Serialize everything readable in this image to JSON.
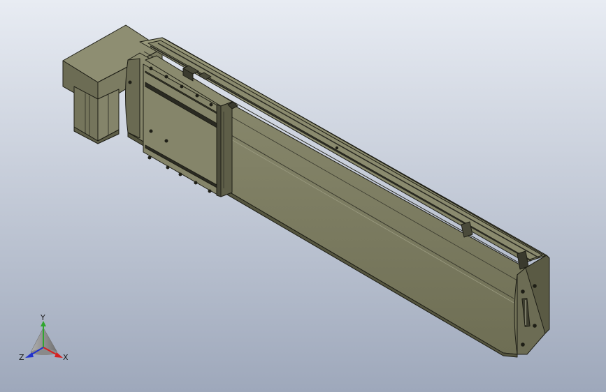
{
  "viewport": {
    "background_top": "#e8ecf3",
    "background_bottom": "#9ea8bb"
  },
  "model": {
    "body_light": "#8a8a6c",
    "body_mid": "#7a7a5e",
    "body_dark": "#5e5e48",
    "edge": "#1e1e16",
    "slot": "#2a2a22"
  },
  "triad": {
    "x_label": "X",
    "y_label": "Y",
    "z_label": "Z",
    "x_color": "#d62020",
    "y_color": "#2fa62f",
    "z_color": "#2233cc"
  }
}
